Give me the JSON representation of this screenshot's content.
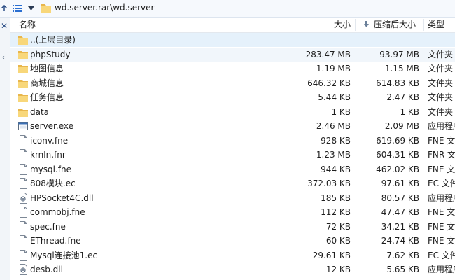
{
  "toolbar": {
    "path": "wd.server.rar\\wd.server"
  },
  "columns": {
    "name": "名称",
    "size": "大小",
    "compressed": "压缩后大小",
    "type": "类型"
  },
  "files": [
    {
      "name": "..(上层目录)",
      "size": "",
      "compressed": "",
      "type": "",
      "icon": "folder-icon"
    },
    {
      "name": "phpStudy",
      "size": "283.47 MB",
      "compressed": "93.97 MB",
      "type": "文件夹",
      "icon": "folder-icon"
    },
    {
      "name": "地图信息",
      "size": "1.19 MB",
      "compressed": "1.15 MB",
      "type": "文件夹",
      "icon": "folder-icon"
    },
    {
      "name": "商城信息",
      "size": "646.32 KB",
      "compressed": "614.83 KB",
      "type": "文件夹",
      "icon": "folder-icon"
    },
    {
      "name": "任务信息",
      "size": "5.44 KB",
      "compressed": "2.47 KB",
      "type": "文件夹",
      "icon": "folder-icon"
    },
    {
      "name": "data",
      "size": "1 KB",
      "compressed": "1 KB",
      "type": "文件夹",
      "icon": "folder-icon"
    },
    {
      "name": "server.exe",
      "size": "2.46 MB",
      "compressed": "2.09 MB",
      "type": "应用程序",
      "icon": "exe-icon"
    },
    {
      "name": "iconv.fne",
      "size": "928 KB",
      "compressed": "619.69 KB",
      "type": "FNE 文",
      "icon": "file-icon"
    },
    {
      "name": "krnln.fnr",
      "size": "1.23 MB",
      "compressed": "604.31 KB",
      "type": "FNR 文",
      "icon": "file-icon"
    },
    {
      "name": "mysql.fne",
      "size": "944 KB",
      "compressed": "462.02 KB",
      "type": "FNE 文",
      "icon": "file-icon"
    },
    {
      "name": "808模块.ec",
      "size": "372.03 KB",
      "compressed": "97.61 KB",
      "type": "EC 文件",
      "icon": "file-icon"
    },
    {
      "name": "HPSocket4C.dll",
      "size": "185 KB",
      "compressed": "80.57 KB",
      "type": "应用程序",
      "icon": "dll-icon"
    },
    {
      "name": "commobj.fne",
      "size": "112 KB",
      "compressed": "47.47 KB",
      "type": "FNE 文",
      "icon": "file-icon"
    },
    {
      "name": "spec.fne",
      "size": "72 KB",
      "compressed": "34.21 KB",
      "type": "FNE 文",
      "icon": "file-icon"
    },
    {
      "name": "EThread.fne",
      "size": "60 KB",
      "compressed": "24.74 KB",
      "type": "FNE 文",
      "icon": "file-icon"
    },
    {
      "name": "Mysql连接池1.ec",
      "size": "29.61 KB",
      "compressed": "7.62 KB",
      "type": "EC 文件",
      "icon": "file-icon"
    },
    {
      "name": "desb.dll",
      "size": "12 KB",
      "compressed": "5.65 KB",
      "type": "应用程序",
      "icon": "dll-icon"
    }
  ]
}
